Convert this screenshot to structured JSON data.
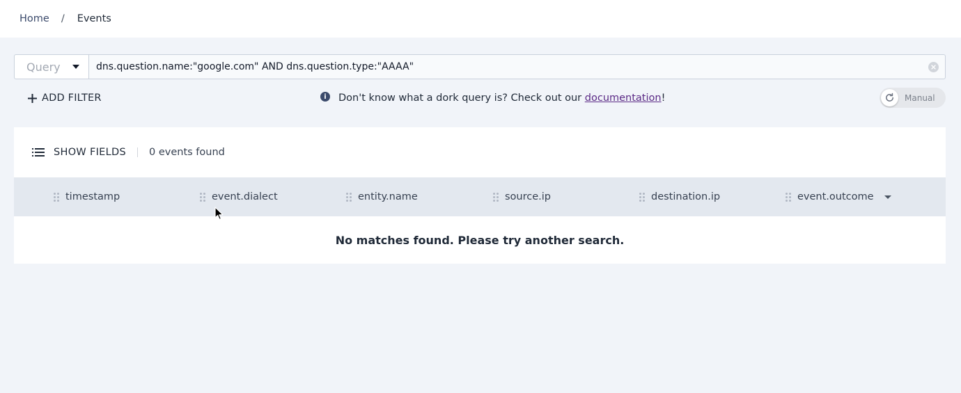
{
  "breadcrumb": {
    "home": "Home",
    "separator": "/",
    "current": "Events"
  },
  "query": {
    "type_label": "Query",
    "value": "dns.question.name:\"google.com\" AND dns.question.type:\"AAAA\""
  },
  "filter": {
    "add_label": "ADD FILTER",
    "hint_before": "Don't know what a dork query is? Check out our ",
    "hint_link": "documentation",
    "hint_after": "!"
  },
  "refresh": {
    "mode_label": "Manual"
  },
  "results": {
    "show_fields_label": "SHOW FIELDS",
    "count_text": "0 events found",
    "columns": [
      "timestamp",
      "event.dialect",
      "entity.name",
      "source.ip",
      "destination.ip",
      "event.outcome"
    ],
    "empty_message": "No matches found. Please try another search."
  },
  "icons": {
    "caret": "chevron-down-icon",
    "clear": "clear-icon",
    "plus": "plus-icon",
    "info": "info-icon",
    "refresh": "refresh-icon",
    "list": "list-icon",
    "grip": "drag-handle-icon",
    "sort": "sort-down-icon",
    "cursor": "mouse-cursor-icon"
  },
  "colors": {
    "page_bg": "#f1f4f9",
    "header_bg": "#e3e8ef",
    "link": "#5b2a86",
    "accent": "#3b4a6b"
  }
}
